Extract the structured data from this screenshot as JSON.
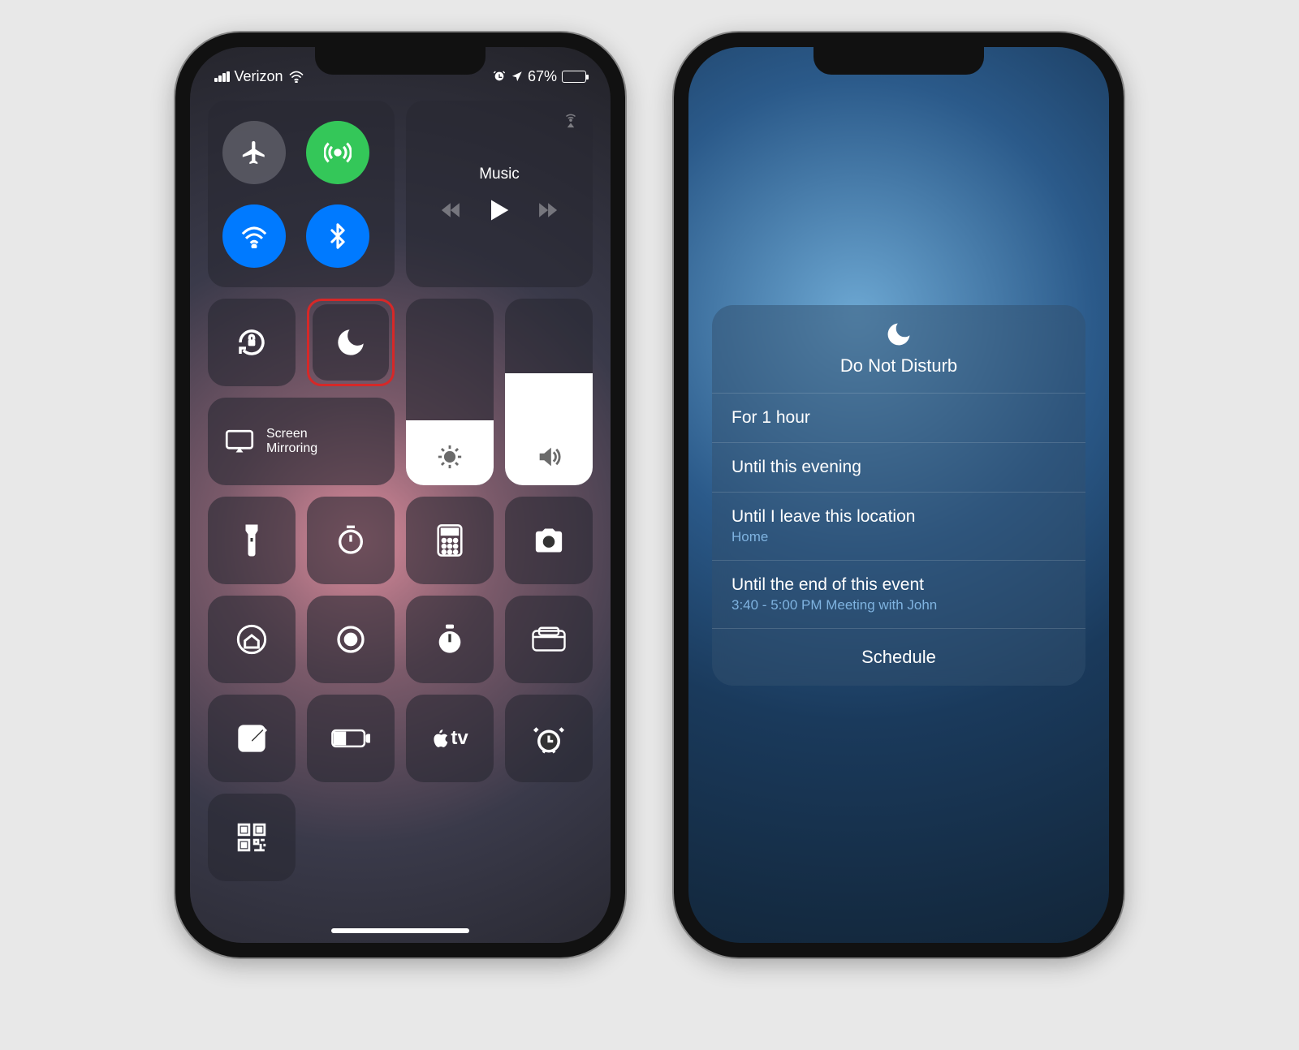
{
  "status": {
    "carrier": "Verizon",
    "battery_pct": "67%"
  },
  "music": {
    "label": "Music"
  },
  "screen_mirroring": {
    "label": "Screen\nMirroring"
  },
  "dnd_panel": {
    "title": "Do Not Disturb",
    "options": [
      {
        "label": "For 1 hour",
        "sub": ""
      },
      {
        "label": "Until this evening",
        "sub": ""
      },
      {
        "label": "Until I leave this location",
        "sub": "Home"
      },
      {
        "label": "Until the end of this event",
        "sub": "3:40 - 5:00 PM Meeting with John"
      }
    ],
    "schedule": "Schedule"
  }
}
